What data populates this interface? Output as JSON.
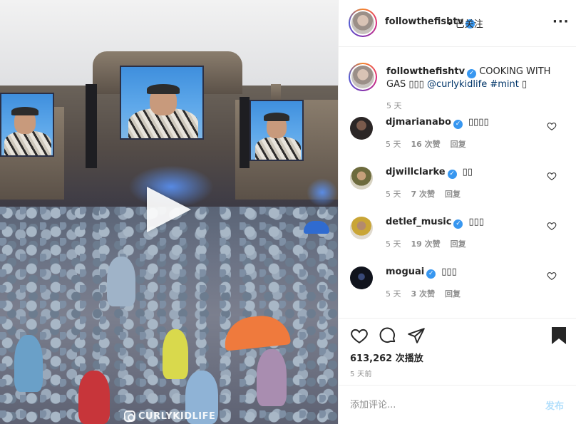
{
  "post": {
    "username": "followthefishtv",
    "follow_status": "• 已关注",
    "more_icon": "more-horizontal-icon",
    "verified_icon": "verified-badge-icon"
  },
  "caption": {
    "username": "followthefishtv",
    "text_before": "COOKING WITH GAS ",
    "emoji": "▯▯▯",
    "mention": "@curlykidlife",
    "hashtag": "#mint",
    "emoji_end": "▯",
    "time": "5 天"
  },
  "comments": [
    {
      "username": "djmarianabo",
      "text": "▯▯▯▯",
      "time": "5 天",
      "likes": "16 次赞",
      "reply": "回复"
    },
    {
      "username": "djwillclarke",
      "text": "▯▯",
      "time": "5 天",
      "likes": "7 次赞",
      "reply": "回复"
    },
    {
      "username": "detlef_music",
      "text": "▯▯▯",
      "time": "5 天",
      "likes": "19 次赞",
      "reply": "回复"
    },
    {
      "username": "moguai",
      "text": "▯▯▯",
      "time": "5 天",
      "likes": "3 次赞",
      "reply": "回复"
    }
  ],
  "stats": {
    "views": "613,262 次播放",
    "posted": "5 天前"
  },
  "composer": {
    "placeholder": "添加评论...",
    "post_label": "发布"
  },
  "media": {
    "watermark": "CURLYKIDLIFE",
    "play_icon": "play-icon"
  },
  "colors": {
    "accent": "#3897f0",
    "link": "#003569",
    "muted": "#8e8e8e",
    "post_disabled": "#b2dffc"
  }
}
